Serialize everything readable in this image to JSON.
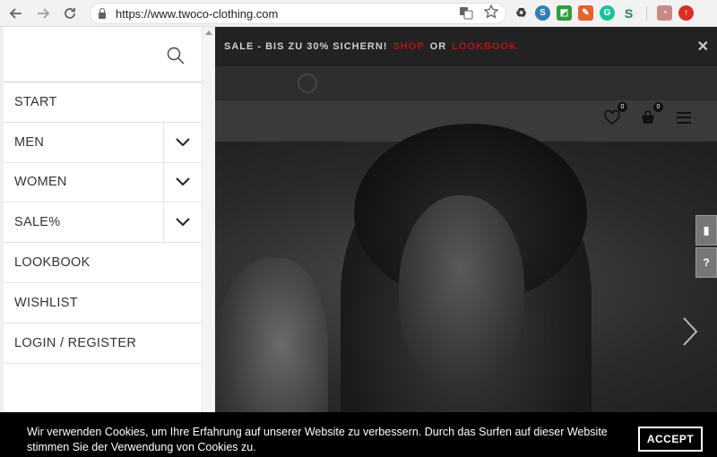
{
  "browser": {
    "url": "https://www.twoco-clothing.com"
  },
  "promo": {
    "text": "SALE - BIS ZU 30% SICHERN!",
    "link1": "SHOP",
    "connector": "OR",
    "link2": "LOOKBOOK"
  },
  "header": {
    "wishlist_count": "0",
    "cart_count": "0"
  },
  "menu": {
    "items": [
      {
        "label": "START",
        "has_submenu": false
      },
      {
        "label": "MEN",
        "has_submenu": true
      },
      {
        "label": "WOMEN",
        "has_submenu": true
      },
      {
        "label": "SALE%",
        "has_submenu": true
      },
      {
        "label": "LOOKBOOK",
        "has_submenu": false
      },
      {
        "label": "WISHLIST",
        "has_submenu": false
      },
      {
        "label": "LOGIN / REGISTER",
        "has_submenu": false
      }
    ]
  },
  "cookie": {
    "text": "Wir verwenden Cookies, um Ihre Erfahrung auf unserer Website zu verbessern. Durch das Surfen auf dieser Website stimmen Sie der Verwendung von Cookies zu.",
    "accept_label": "ACCEPT"
  },
  "colors": {
    "promo_link": "#b0141a",
    "overlay": "#1c1c1e",
    "cookie_bg": "#000000"
  }
}
